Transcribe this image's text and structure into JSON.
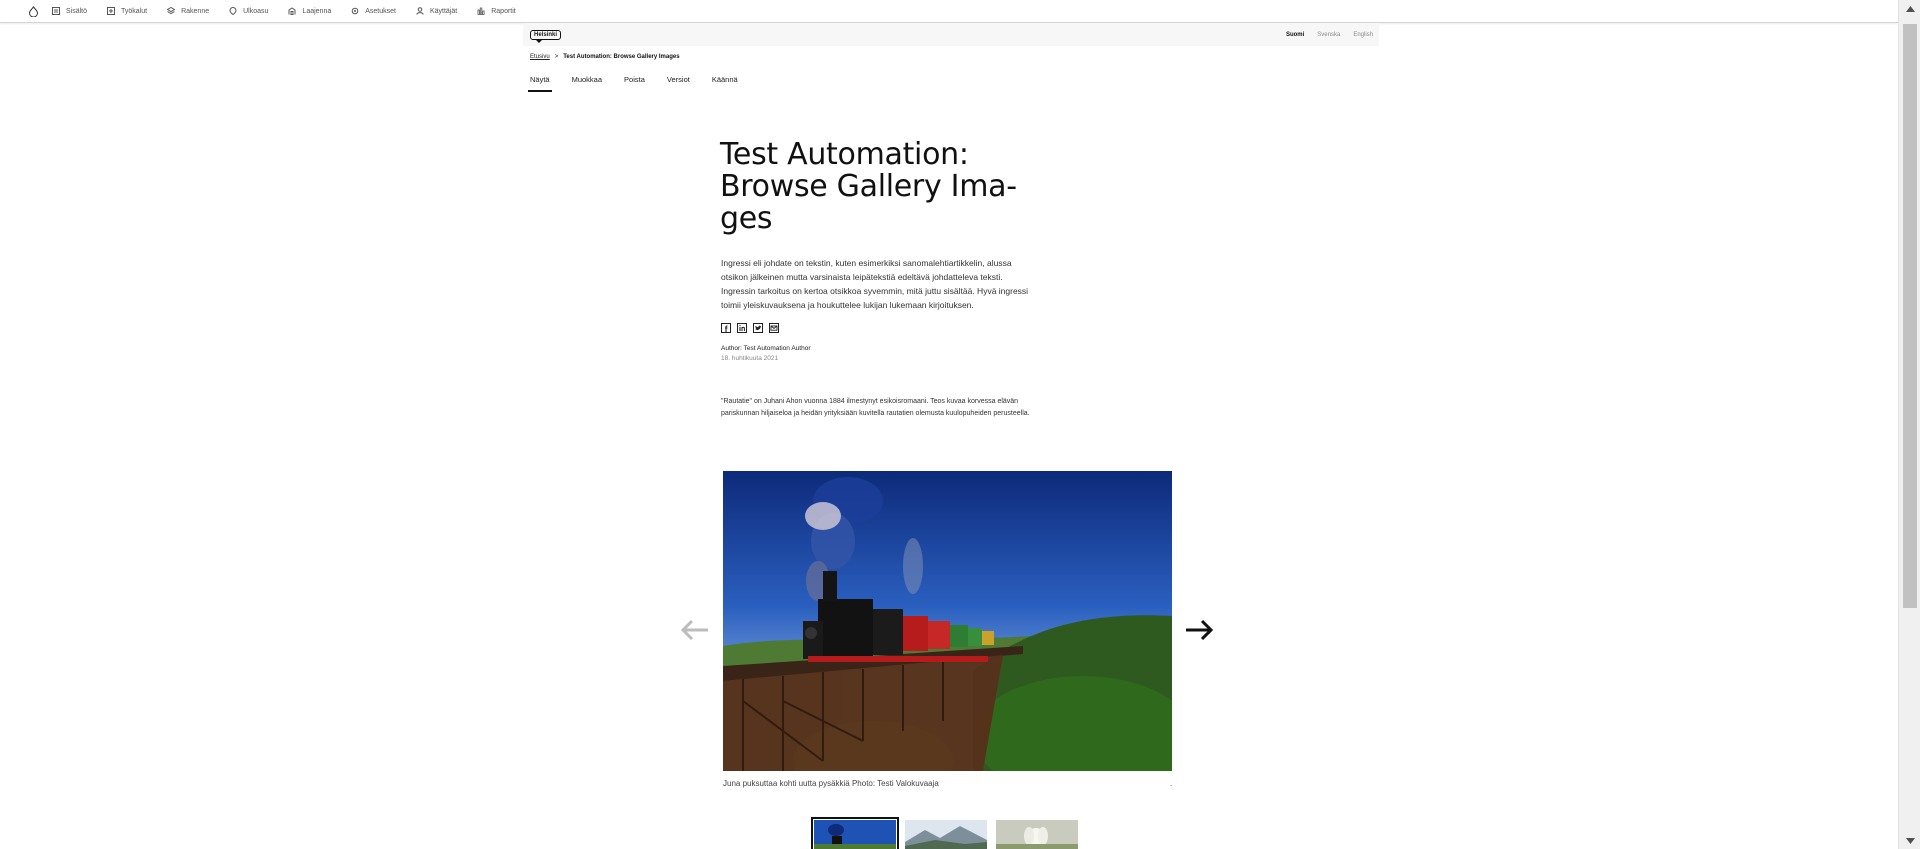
{
  "toolbar": {
    "items": [
      {
        "label": "Sisältö",
        "icon": "content-icon"
      },
      {
        "label": "Työkalut",
        "icon": "tools-icon"
      },
      {
        "label": "Rakenne",
        "icon": "structure-icon"
      },
      {
        "label": "Ulkoasu",
        "icon": "appearance-icon"
      },
      {
        "label": "Laajennа",
        "icon": "extend-icon"
      },
      {
        "label": "Asetukset",
        "icon": "settings-icon"
      },
      {
        "label": "Käyttäjät",
        "icon": "people-icon"
      },
      {
        "label": "Raportit",
        "icon": "reports-icon"
      }
    ]
  },
  "header": {
    "logo": "Helsinki",
    "languages": [
      "Suomi",
      "Svenska",
      "English"
    ],
    "active_language": "Suomi"
  },
  "breadcrumb": {
    "home": "Etusivu",
    "separator": ">",
    "current": "Test Automation: Browse Gallery Images"
  },
  "tabs": [
    "Näytä",
    "Muokkaa",
    "Poista",
    "Versiot",
    "Käännä"
  ],
  "article": {
    "title": "Test Automation: Browse Gallery Ima-ges",
    "lead": "Ingressi eli johdate on tekstin, kuten esimerkiksi sanomalehtiartikkelin, alussa otsikon jälkeinen mutta varsinaista leipätekstiä edeltävä johdatteleva teksti. Ingressin tarkoitus on kertoa otsikkoa syvemmin, mitä juttu sisältää. Hyvä ingressi toimii yleiskuvauksena ja houkuttelee lukijan lukemaan kirjoituksen.",
    "share_icons": [
      "facebook-icon",
      "linkedin-icon",
      "twitter-icon",
      "email-icon"
    ],
    "author": "Author: Test Automation Author",
    "date": "18. huhtikuuta 2021",
    "body": "\"Rautatie\" on Juhani Ahon vuonna 1884 ilmestynyt esikoisromaani. Teos kuvaa korvessa elävän pariskunnan hiljaiseloa ja heidän yrityksiään kuvitella rautatien olemusta kuulopuheiden perusteella."
  },
  "gallery": {
    "caption": "Juna puksuttaa kohti uutta pysäkkiä Photo: Testi Valokuvaaja",
    "caption_trailing": ".",
    "prev_label": "←",
    "next_label": "→",
    "thumbnails": [
      "train",
      "mountains",
      "flower"
    ]
  }
}
